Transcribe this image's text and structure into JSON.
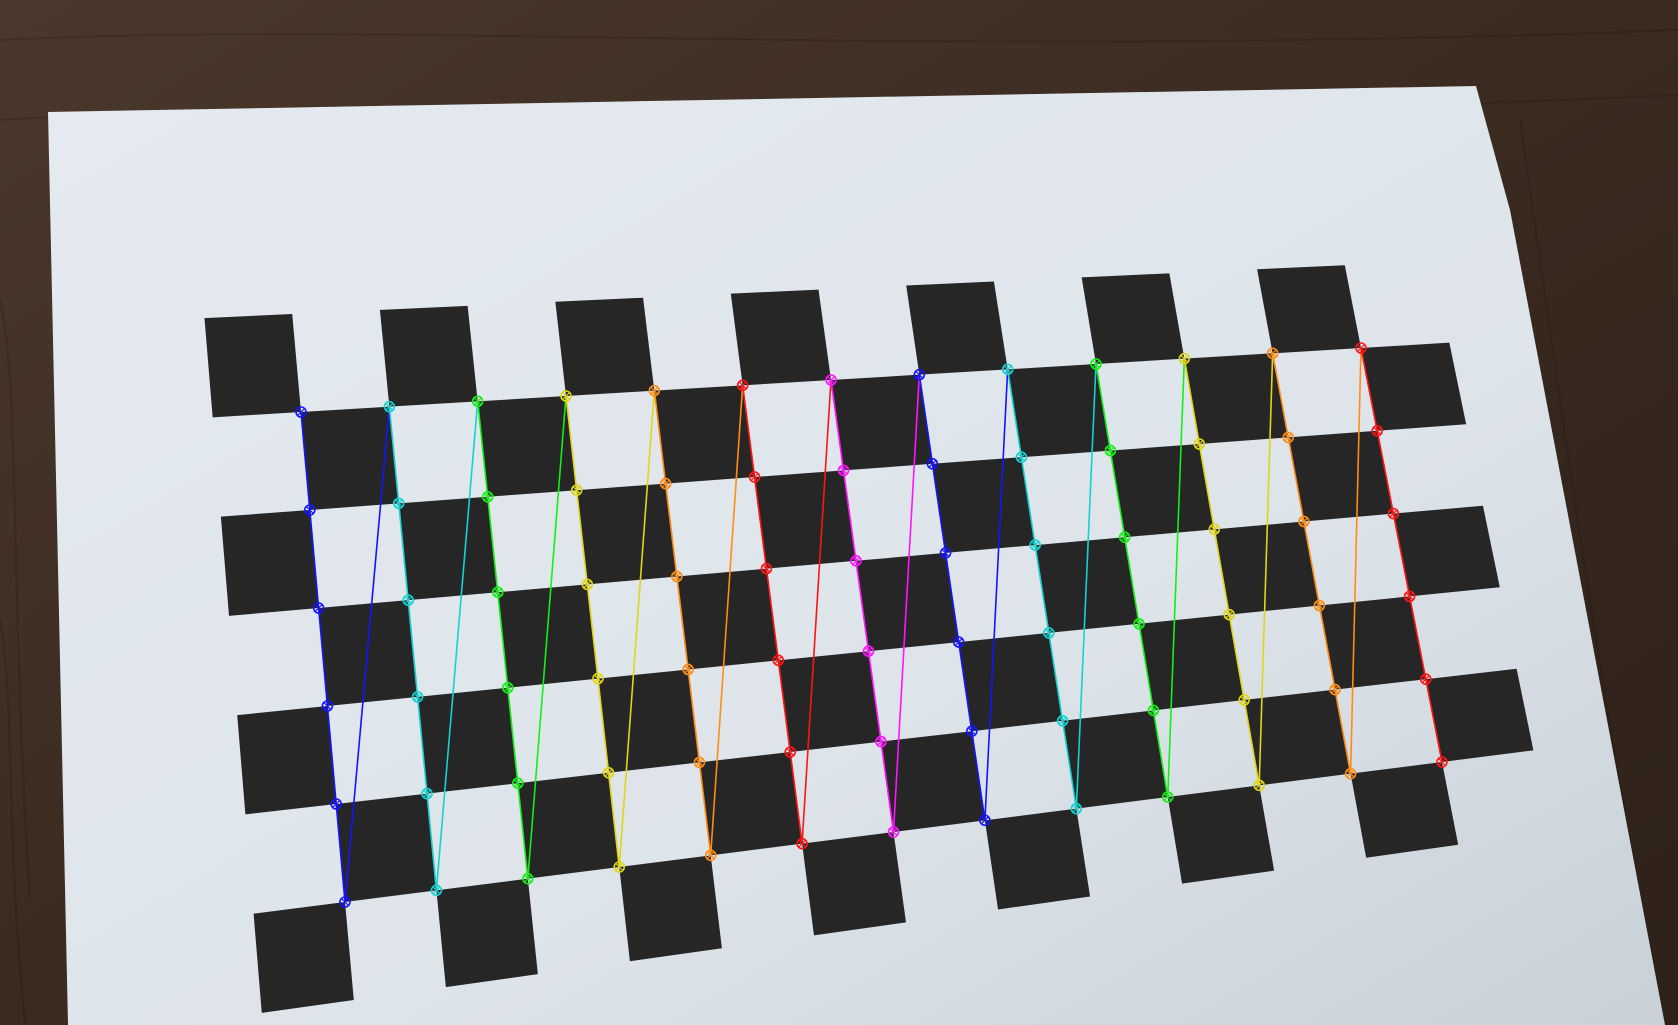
{
  "scene": {
    "subject": "checkerboard-calibration-pattern",
    "board": {
      "inner_corner_columns": 13,
      "inner_corner_rows": 6,
      "square_color": "#262626",
      "paper_color": "#dde4ea"
    },
    "overlay": {
      "style": "detected-corners-zigzag",
      "column_colors": [
        "#1414ff",
        "#14d2d2",
        "#14f014",
        "#e1d614",
        "#ff8c14",
        "#ff1414",
        "#ff14ff",
        "#1414ff",
        "#14d2d2",
        "#14f014",
        "#e1d614",
        "#ff8c14",
        "#ff1414"
      ]
    },
    "background": {
      "material": "wood-desk",
      "color": "#3c2c22"
    }
  }
}
